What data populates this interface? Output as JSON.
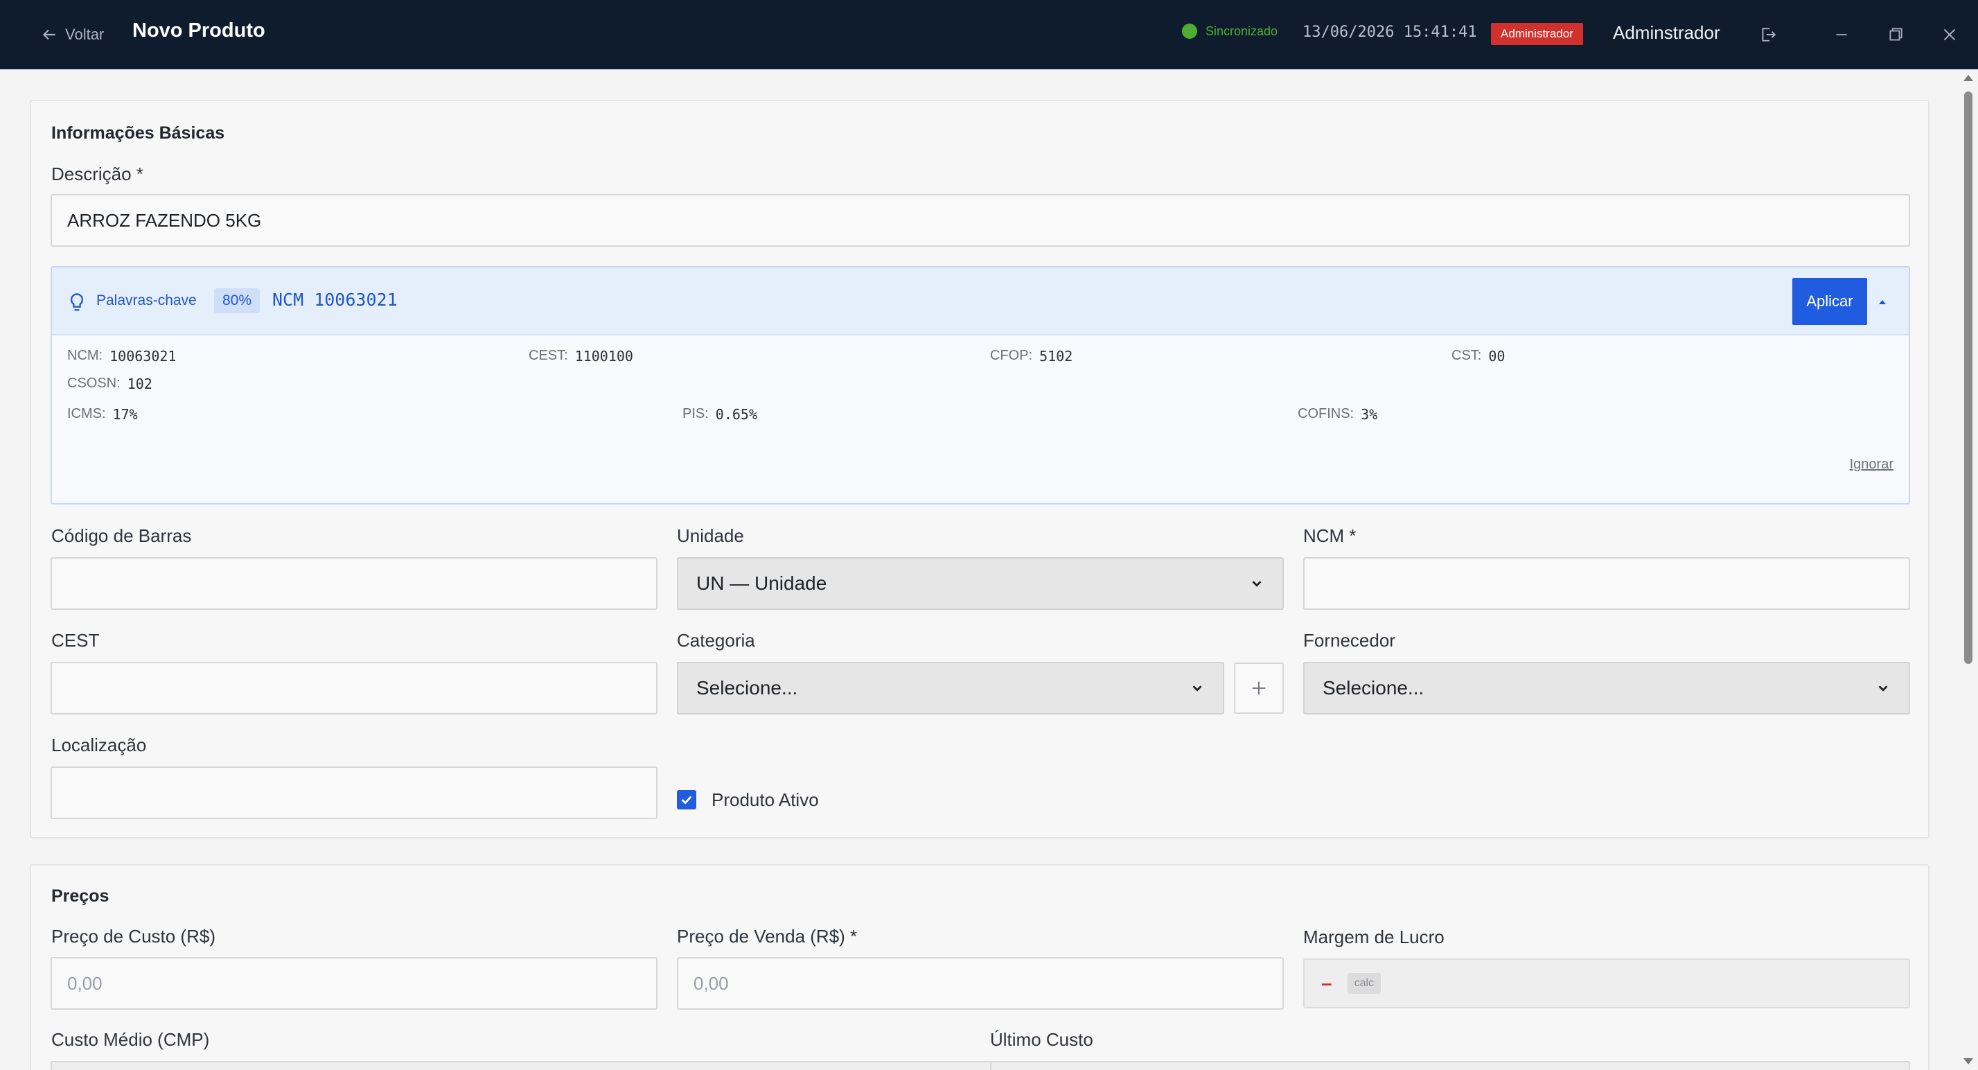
{
  "titlebar": {
    "back_label": "Voltar",
    "title": "Novo Produto",
    "sync_status": "Sincronizado",
    "sync_color": "#4caf2f",
    "datetime": "13/06/2026 15:41:41",
    "role_badge": "Administrador",
    "role_badge_color": "#d0312d",
    "user_name": "Adminstrador"
  },
  "basic": {
    "section_title": "Informações Básicas",
    "descricao_label": "Descrição *",
    "descricao_value": "ARROZ FAZENDO 5KG",
    "suggestion": {
      "keyword_label": "Palavras-chave",
      "confidence": "80%",
      "ncm_header": "NCM 10063021",
      "apply_label": "Aplicar",
      "ignore_label": "Ignorar",
      "fields": {
        "ncm_label": "NCM:",
        "ncm_value": "10063021",
        "cest_label": "CEST:",
        "cest_value": "1100100",
        "cfop_label": "CFOP:",
        "cfop_value": "5102",
        "cst_label": "CST:",
        "cst_value": "00",
        "csosn_label": "CSOSN:",
        "csosn_value": "102",
        "icms_label": "ICMS:",
        "icms_value": "17%",
        "pis_label": "PIS:",
        "pis_value": "0.65%",
        "cofins_label": "COFINS:",
        "cofins_value": "3%"
      }
    },
    "barcode_label": "Código de Barras",
    "barcode_value": "",
    "unidade_label": "Unidade",
    "unidade_value": "UN — Unidade",
    "ncm_label": "NCM *",
    "ncm_value": "",
    "cest_label": "CEST",
    "cest_value": "",
    "categoria_label": "Categoria",
    "categoria_value": "Selecione...",
    "fornecedor_label": "Fornecedor",
    "fornecedor_value": "Selecione...",
    "localizacao_label": "Localização",
    "localizacao_value": "",
    "ativo_label": "Produto Ativo",
    "ativo_checked": true
  },
  "prices": {
    "section_title": "Preços",
    "custo_label": "Preço de Custo (R$)",
    "custo_placeholder": "0,00",
    "venda_label": "Preço de Venda (R$) *",
    "venda_placeholder": "0,00",
    "margem_label": "Margem de Lucro",
    "margem_value": "–",
    "margem_badge": "calc",
    "cmp_label": "Custo Médio (CMP)",
    "ultimo_label": "Último Custo"
  },
  "accent_color": "#1f5ce0"
}
